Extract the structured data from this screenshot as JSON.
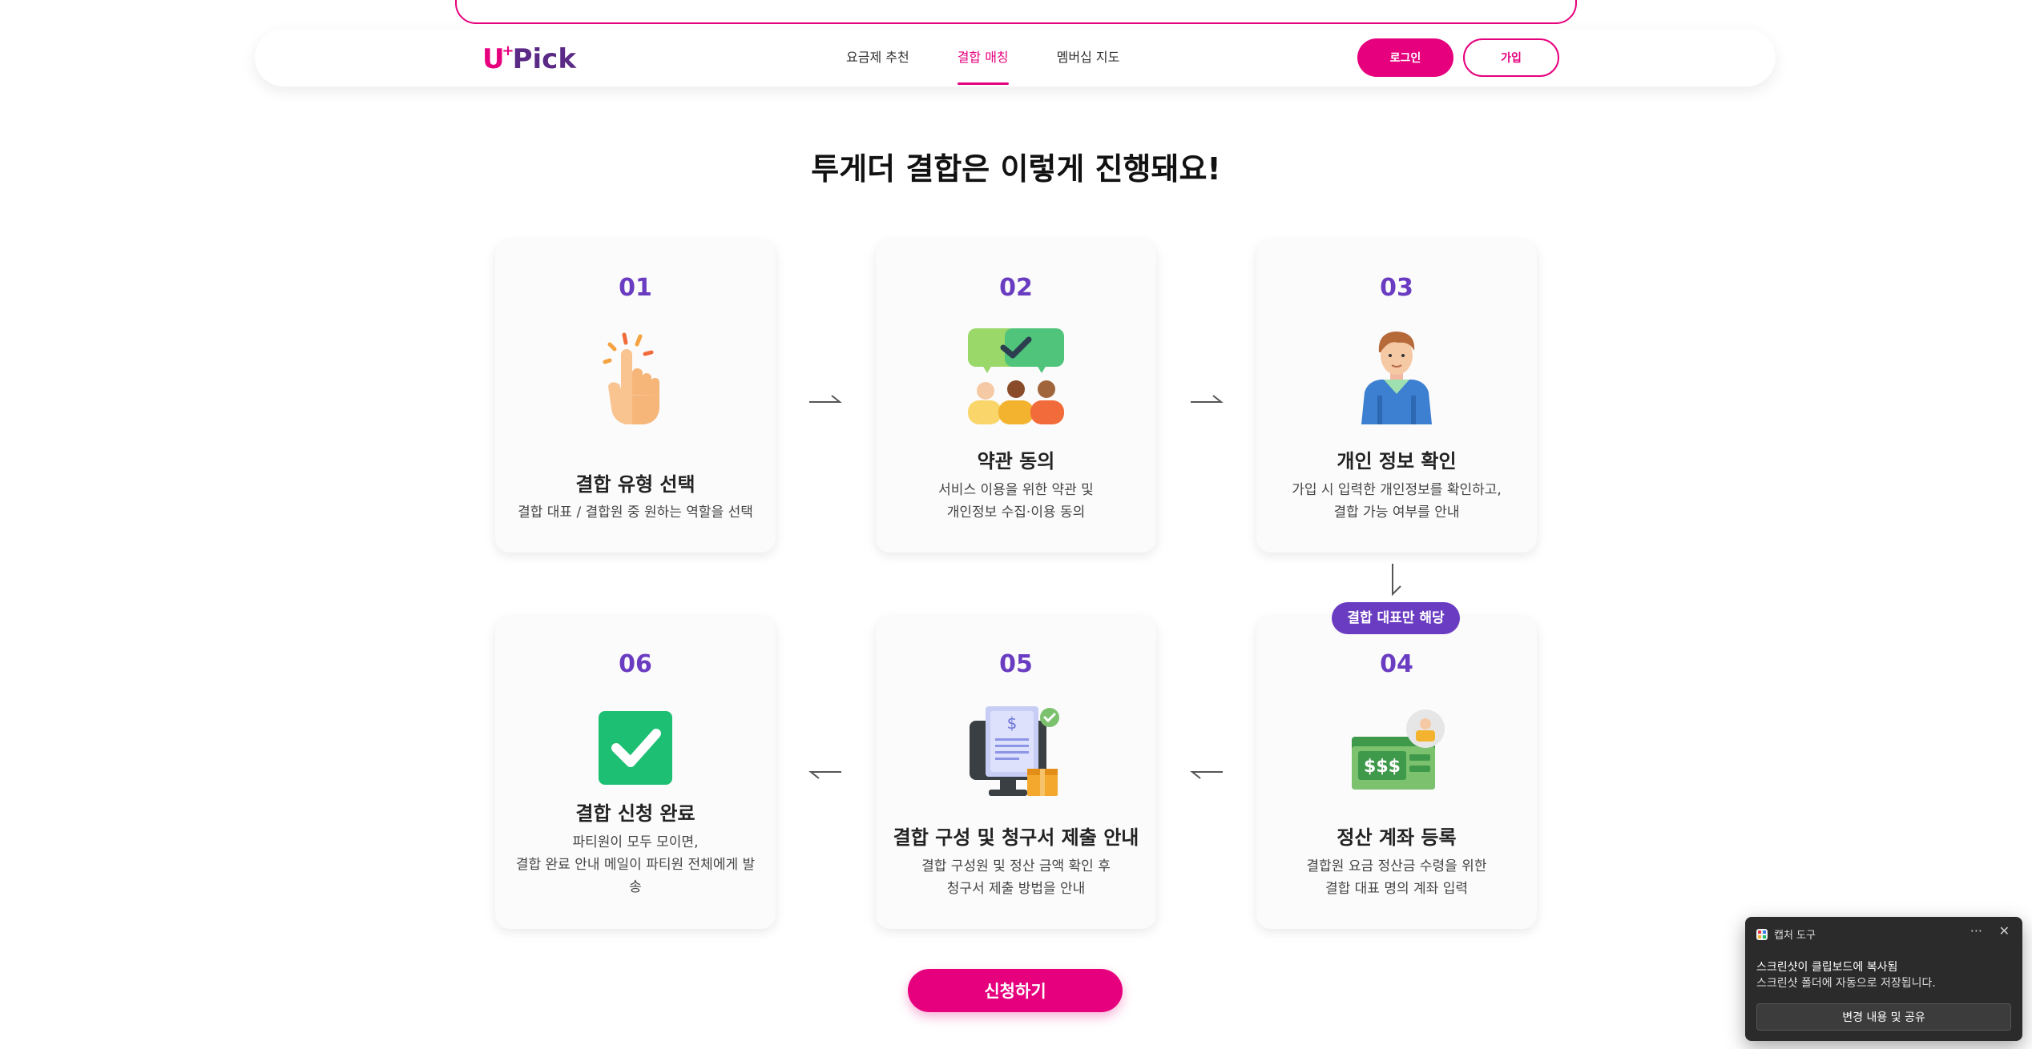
{
  "header": {
    "logo_u": "U",
    "logo_plus": "+",
    "logo_pick": "Pick",
    "nav": [
      {
        "label": "요금제 추천",
        "active": false
      },
      {
        "label": "결합 매칭",
        "active": true
      },
      {
        "label": "멤버십 지도",
        "active": false
      }
    ],
    "login_label": "로그인",
    "join_label": "가입"
  },
  "main": {
    "title": "투게더 결합은 이렇게 진행돼요!",
    "badge": "결합 대표만 해당",
    "cta_label": "신청하기",
    "steps": [
      {
        "num": "01",
        "title": "결합 유형 선택",
        "desc1": "결합 대표 / 결합원 중 원하는 역할을 선택",
        "desc2": "",
        "desc3": "",
        "icon": "pointing-hand-icon"
      },
      {
        "num": "02",
        "title": "약관 동의",
        "desc1": "서비스 이용을 위한 약관 및",
        "desc2": "개인정보 수집·이용 동의",
        "desc3": "",
        "icon": "group-agree-icon"
      },
      {
        "num": "03",
        "title": "개인 정보 확인",
        "desc1": "가입 시 입력한 개인정보를 확인하고,",
        "desc2": "결합 가능 여부를 안내",
        "desc3": "",
        "icon": "person-icon"
      },
      {
        "num": "04",
        "title": "정산 계좌 등록",
        "desc1": "결합원 요금 정산금 수령을 위한",
        "desc2": "결합 대표 명의 계좌 입력",
        "desc3": "",
        "icon": "money-account-icon"
      },
      {
        "num": "05",
        "title": "결합 구성 및 청구서 제출 안내",
        "desc1": "결합 구성원 및 정산 금액 확인 후",
        "desc2": "청구서 제출 방법을 안내",
        "desc3": "",
        "icon": "invoice-monitor-icon"
      },
      {
        "num": "06",
        "title": "결합 신청 완료",
        "desc1": "파티원이 모두 모이면,",
        "desc2": "결합 완료 안내 메일이 파티원 전체에게 발",
        "desc3": "송",
        "icon": "check-square-icon"
      }
    ]
  },
  "toast": {
    "app_name": "캡처 도구",
    "more": "···",
    "close": "✕",
    "line1": "스크린샷이 클립보드에 복사됨",
    "line2": "스크린샷 폴더에 자동으로 저장됩니다.",
    "button": "변경 내용 및 공유"
  },
  "colors": {
    "brand_pink": "#e6007e",
    "brand_purple": "#6a3cc1",
    "logo_purple": "#5b2a86"
  }
}
